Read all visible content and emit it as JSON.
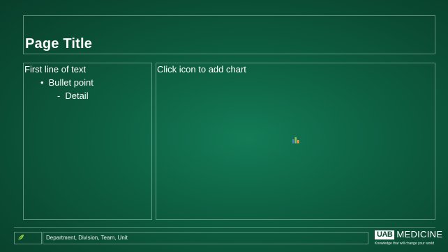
{
  "slide": {
    "title": "Page Title",
    "left_placeholder": {
      "line1": "First line of text",
      "bullet": "Bullet point",
      "detail": "Detail",
      "bullet_glyph": "•",
      "detail_glyph": "-"
    },
    "right_placeholder": {
      "prompt": "Click icon to add chart",
      "icon": "insert-chart-icon"
    }
  },
  "footer": {
    "text": "Department, Division, Team, Unit",
    "icon": "leaf-icon",
    "brand": {
      "logo_mark": "UAB",
      "name": "MEDICINE",
      "tagline": "Knowledge that will change your world"
    }
  },
  "colors": {
    "background": "#0d5f42",
    "text": "#ffffff",
    "chart_bar_1": "#4f81bd",
    "chart_bar_2": "#9bbb59",
    "chart_bar_3": "#f79646",
    "leaf": "#8dc63f"
  }
}
